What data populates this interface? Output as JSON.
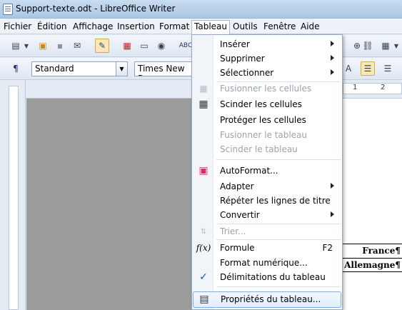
{
  "window": {
    "title": "Support-texte.odt - LibreOffice Writer"
  },
  "menubar": [
    "Fichier",
    "Édition",
    "Affichage",
    "Insertion",
    "Format",
    "Tableau",
    "Outils",
    "Fenêtre",
    "Aide"
  ],
  "formatting": {
    "style": "Standard",
    "font": "Times New Ro"
  },
  "ruler": {
    "label1": "1",
    "label2": "2"
  },
  "table_menu": {
    "items": [
      {
        "label": "Insérer",
        "enabled": true,
        "submenu": true
      },
      {
        "label": "Supprimer",
        "enabled": true,
        "submenu": true
      },
      {
        "label": "Sélectionner",
        "enabled": true,
        "submenu": true
      },
      {
        "label": "Fusionner les cellules",
        "enabled": false
      },
      {
        "label": "Scinder les cellules",
        "enabled": true
      },
      {
        "label": "Protéger les cellules",
        "enabled": true
      },
      {
        "label": "Fusionner le tableau",
        "enabled": false
      },
      {
        "label": "Scinder le tableau",
        "enabled": false
      },
      {
        "label": "AutoFormat...",
        "enabled": true
      },
      {
        "label": "Adapter",
        "enabled": true,
        "submenu": true
      },
      {
        "label": "Répéter les lignes de titre",
        "enabled": true
      },
      {
        "label": "Convertir",
        "enabled": true,
        "submenu": true
      },
      {
        "label": "Trier...",
        "enabled": false
      },
      {
        "label": "Formule",
        "enabled": true,
        "shortcut": "F2"
      },
      {
        "label": "Format numérique...",
        "enabled": true
      },
      {
        "label": "Délimitations du tableau",
        "enabled": true,
        "checked": true
      },
      {
        "label": "Propriétés du tableau...",
        "enabled": true,
        "highlighted": true
      }
    ]
  },
  "document": {
    "cells": [
      "France¶",
      "Allemagne¶"
    ]
  }
}
